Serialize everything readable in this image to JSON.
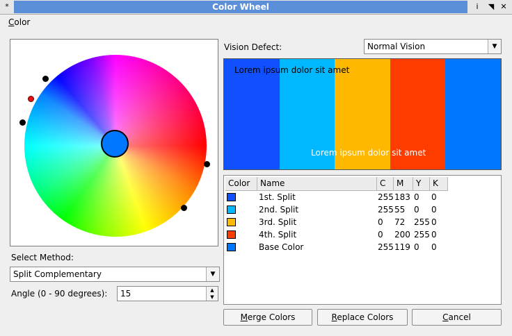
{
  "window": {
    "title": "Color Wheel",
    "buttons": [
      "*",
      "i",
      "◥",
      "✕"
    ]
  },
  "menu": {
    "items": [
      {
        "accel": "C",
        "rest": "olor"
      }
    ]
  },
  "wheel": {
    "base_color": "#0077ff"
  },
  "method": {
    "label": "Select Method:",
    "value": "Split Complementary"
  },
  "angle": {
    "label": "Angle (0 - 90 degrees):",
    "value": "15"
  },
  "vision": {
    "label": "Vision Defect:",
    "value": "Normal Vision"
  },
  "preview": {
    "text_top": "Lorem ipsum dolor sit amet",
    "text_bottom": "Lorem ipsum dolor sit amet",
    "stripes": [
      "#1050ff",
      "#00b8ff",
      "#ffb800",
      "#ff3c00",
      "#0077ff"
    ]
  },
  "table": {
    "headers": [
      "Color",
      "Name",
      "C",
      "M",
      "Y",
      "K"
    ],
    "rows": [
      {
        "color": "#1050ff",
        "name": "1st. Split",
        "c": "255",
        "m": "183",
        "y": "0",
        "k": "0"
      },
      {
        "color": "#00b8ff",
        "name": "2nd. Split",
        "c": "255",
        "m": "55",
        "y": "0",
        "k": "0"
      },
      {
        "color": "#ffb800",
        "name": "3rd. Split",
        "c": "0",
        "m": "72",
        "y": "255",
        "k": "0"
      },
      {
        "color": "#ff3c00",
        "name": "4th. Split",
        "c": "0",
        "m": "200",
        "y": "255",
        "k": "0"
      },
      {
        "color": "#0077ff",
        "name": "Base Color",
        "c": "255",
        "m": "119",
        "y": "0",
        "k": "0"
      }
    ]
  },
  "buttons": {
    "merge": {
      "accel": "M",
      "rest": "erge Colors"
    },
    "replace": {
      "accel": "R",
      "rest": "eplace Colors"
    },
    "cancel": {
      "accel": "C",
      "rest": "ancel"
    }
  }
}
